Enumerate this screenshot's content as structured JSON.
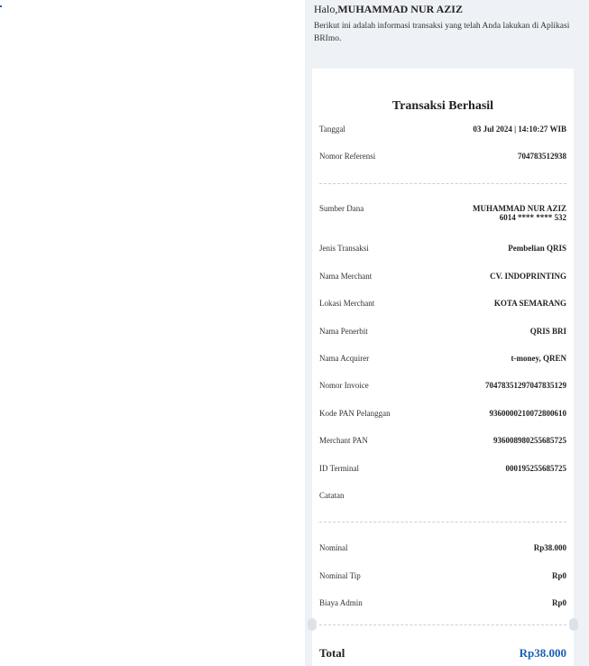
{
  "greeting": {
    "prefix": "Halo,",
    "name": "MUHAMMAD NUR AZIZ"
  },
  "intro": "Berikut ini adalah informasi transaksi yang telah Anda lakukan di Aplikasi BRImo.",
  "receipt": {
    "title": "Transaksi Berhasil",
    "header_rows": [
      {
        "label": "Tanggal",
        "value": "03 Jul 2024 | 14:10:27 WIB"
      },
      {
        "label": "Nomor Referensi",
        "value": "704783512938"
      }
    ],
    "source": {
      "label": "Sumber Dana",
      "name": "MUHAMMAD NUR AZIZ",
      "account": "6014 **** **** 532"
    },
    "detail_rows": [
      {
        "label": "Jenis Transaksi",
        "value": "Pembelian QRIS"
      },
      {
        "label": "Nama Merchant",
        "value": "CV. INDOPRINTING"
      },
      {
        "label": "Lokasi Merchant",
        "value": "KOTA SEMARANG"
      },
      {
        "label": "Nama Penerbit",
        "value": "QRIS BRI"
      },
      {
        "label": "Nama Acquirer",
        "value": "t-money, QREN"
      },
      {
        "label": "Nomor Invoice",
        "value": "70478351297047835129"
      },
      {
        "label": "Kode PAN Pelanggan",
        "value": "9360000210072800610"
      },
      {
        "label": "Merchant PAN",
        "value": "936008980255685725"
      },
      {
        "label": "ID Terminal",
        "value": "000195255685725"
      },
      {
        "label": "Catatan",
        "value": ""
      }
    ],
    "amount_rows": [
      {
        "label": "Nominal",
        "value": "Rp38.000"
      },
      {
        "label": "Nominal Tip",
        "value": "Rp0"
      },
      {
        "label": "Biaya Admin",
        "value": "Rp0"
      }
    ],
    "total": {
      "label": "Total",
      "value": "Rp38.000"
    }
  },
  "colors": {
    "accent": "#1a5fb4",
    "panel_bg": "#eef1f5"
  }
}
